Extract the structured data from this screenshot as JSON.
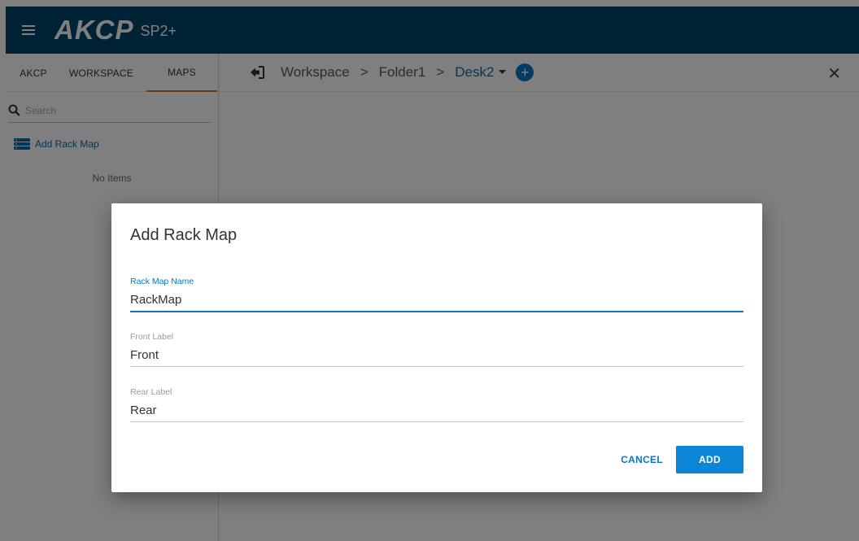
{
  "header": {
    "logo": "AKCP",
    "product": "SP2+"
  },
  "sidebar": {
    "tabs": [
      {
        "label": "AKCP"
      },
      {
        "label": "WORKSPACE"
      },
      {
        "label": "MAPS"
      }
    ],
    "search": {
      "placeholder": "Search",
      "value": ""
    },
    "add_rack_label": "Add Rack Map",
    "empty_text": "No Items"
  },
  "breadcrumb": {
    "items": [
      "Workspace",
      "Folder1",
      "Desk2"
    ],
    "separator": ">",
    "add_label": "+",
    "close_label": "✕"
  },
  "dialog": {
    "title": "Add Rack Map",
    "fields": [
      {
        "label": "Rack Map Name",
        "value": "RackMap"
      },
      {
        "label": "Front Label",
        "value": "Front"
      },
      {
        "label": "Rear Label",
        "value": "Rear"
      }
    ],
    "cancel_label": "CANCEL",
    "add_label": "ADD"
  },
  "colors": {
    "header_bg": "#00456b",
    "accent": "#0b76c1",
    "tab_active_underline": "#d07a1f",
    "add_button": "#0b86d6"
  },
  "icons": [
    "menu-icon",
    "search-icon",
    "rack-list-icon",
    "back-arrow-icon",
    "chevron-down-icon",
    "add-circle-icon",
    "close-icon"
  ]
}
